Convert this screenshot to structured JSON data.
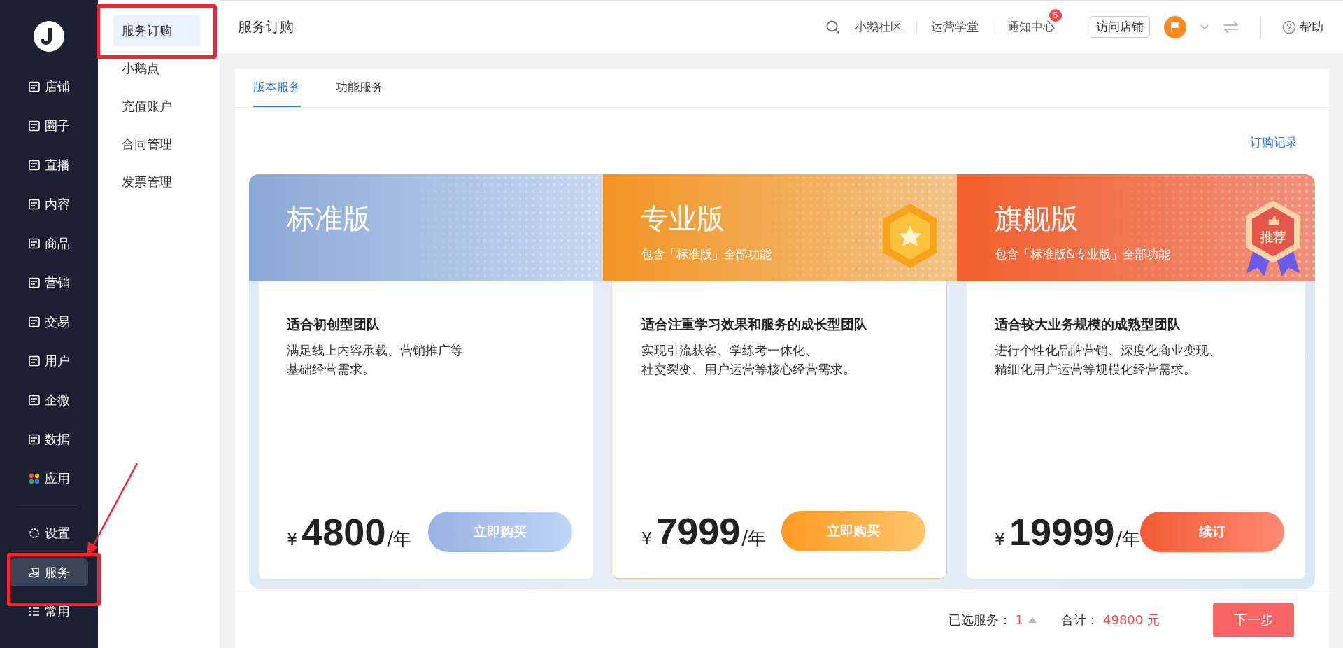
{
  "nav": [
    {
      "label": "店铺",
      "selected": false
    },
    {
      "label": "圈子",
      "selected": false
    },
    {
      "label": "直播",
      "selected": false
    },
    {
      "label": "内容",
      "selected": false
    },
    {
      "label": "商品",
      "selected": false
    },
    {
      "label": "营销",
      "selected": false
    },
    {
      "label": "交易",
      "selected": false
    },
    {
      "label": "用户",
      "selected": false
    },
    {
      "label": "企微",
      "selected": false
    },
    {
      "label": "数据",
      "selected": false
    },
    {
      "label": "应用",
      "selected": false
    }
  ],
  "nav_bottom": [
    {
      "label": "设置",
      "selected": false
    },
    {
      "label": "服务",
      "selected": true
    },
    {
      "label": "常用",
      "selected": false
    }
  ],
  "subnav": [
    {
      "label": "服务订购",
      "selected": true
    },
    {
      "label": "小鹅点",
      "selected": false
    },
    {
      "label": "充值账户",
      "selected": false
    },
    {
      "label": "合同管理",
      "selected": false
    },
    {
      "label": "发票管理",
      "selected": false
    }
  ],
  "header": {
    "title": "服务订购",
    "links": [
      "小鹅社区",
      "运营学堂",
      "通知中心"
    ],
    "notice_badge": "5",
    "visit_store": "访问店铺",
    "help": "帮助"
  },
  "tabs": [
    {
      "label": "版本服务",
      "selected": true
    },
    {
      "label": "功能服务",
      "selected": false
    }
  ],
  "order_link": "订购记录",
  "plans": [
    {
      "kind": "standard",
      "name": "标准版",
      "heading": "适合初创型团队",
      "lines": [
        "满足线上内容承载、营销推广等",
        "基础经营需求。"
      ],
      "currency": "¥",
      "price": "4800",
      "unit": "/年",
      "button": "立即购买"
    },
    {
      "kind": "pro",
      "name": "专业版",
      "subtitle": "包含「标准版」全部功能",
      "heading": "适合注重学习效果和服务的成长型团队",
      "lines": [
        "实现引流获客、学练考一体化、",
        "社交裂变、用户运营等核心经营需求。"
      ],
      "currency": "¥",
      "price": "7999",
      "unit": "/年",
      "button": "立即购买"
    },
    {
      "kind": "flagship",
      "name": "旗舰版",
      "subtitle": "包含「标准版&专业版」全部功能",
      "badge": "推荐",
      "heading": "适合较大业务规模的成熟型团队",
      "lines": [
        "进行个性化品牌营销、深度化商业变现、",
        "精细化用户运营等规模化经营需求。"
      ],
      "currency": "¥",
      "price": "19999",
      "unit": "/年",
      "button": "续订"
    }
  ],
  "footer": {
    "selected_label": "已选服务：",
    "selected_count": "1",
    "total_label": "合计：",
    "total": "49800 元",
    "next": "下一步"
  }
}
